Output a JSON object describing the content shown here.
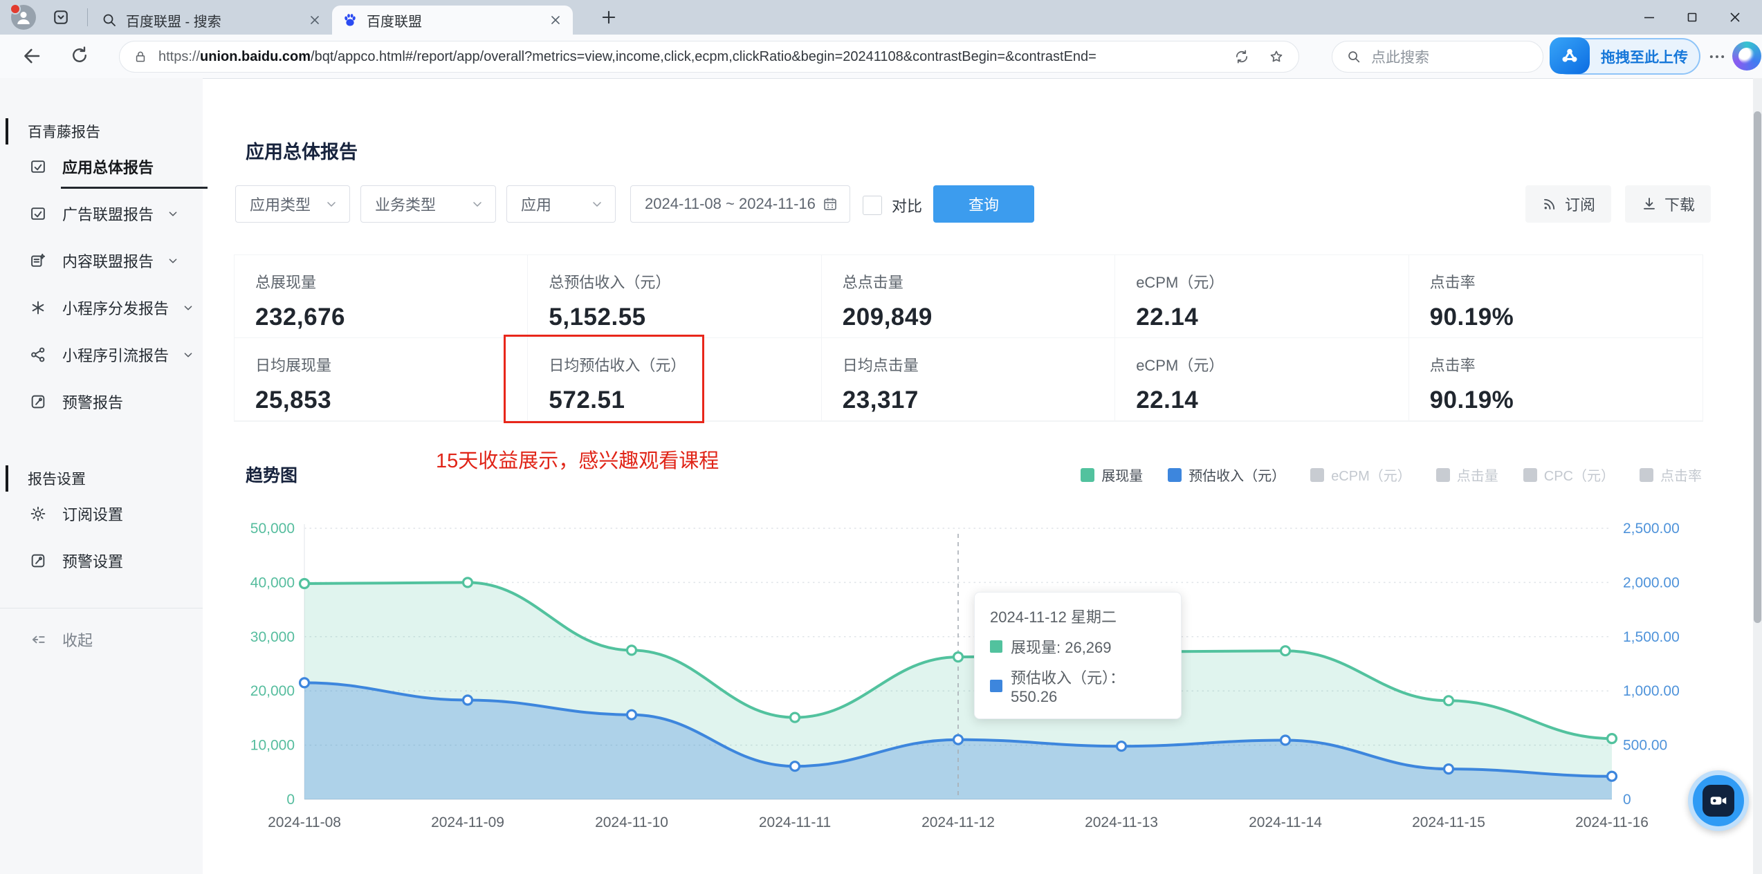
{
  "browser": {
    "tabs": [
      {
        "title": "百度联盟 - 搜索",
        "icon": "search-icon",
        "active": false
      },
      {
        "title": "百度联盟",
        "icon": "baidu-icon",
        "active": true
      }
    ],
    "url": {
      "protocol": "https://",
      "host": "union.baidu.com",
      "path": "/bqt/appco.html#/report/app/overall?metrics=view,income,click,ecpm,clickRatio&begin=20241108&contrastBegin=&contrastEnd="
    },
    "search_placeholder": "点此搜索",
    "netdisk_label": "拖拽至此上传"
  },
  "sidebar": {
    "sections": [
      {
        "header": "百青藤报告",
        "items": [
          {
            "label": "应用总体报告",
            "icon": "overall-report-icon",
            "active": true,
            "chevron": false
          },
          {
            "label": "广告联盟报告",
            "icon": "ad-report-icon",
            "active": false,
            "chevron": true
          },
          {
            "label": "内容联盟报告",
            "icon": "content-report-icon",
            "active": false,
            "chevron": true
          },
          {
            "label": "小程序分发报告",
            "icon": "mini-program-distribute-icon",
            "active": false,
            "chevron": true
          },
          {
            "label": "小程序引流报告",
            "icon": "mini-program-referral-icon",
            "active": false,
            "chevron": true
          },
          {
            "label": "预警报告",
            "icon": "alert-report-icon",
            "active": false,
            "chevron": false
          }
        ]
      },
      {
        "header": "报告设置",
        "items": [
          {
            "label": "订阅设置",
            "icon": "gear-icon",
            "active": false,
            "chevron": false
          },
          {
            "label": "预警设置",
            "icon": "alert-setting-icon",
            "active": false,
            "chevron": false
          }
        ]
      }
    ],
    "collapse_label": "收起"
  },
  "main": {
    "page_title": "应用总体报告",
    "filters": {
      "app_type": "应用类型",
      "biz_type": "业务类型",
      "app": "应用",
      "date_range": "2024-11-08 ~ 2024-11-16",
      "compare_label": "对比",
      "query_label": "查询"
    },
    "actions": {
      "subscribe": "订阅",
      "download": "下载"
    },
    "stats": {
      "rows": [
        [
          {
            "label": "总展现量",
            "value": "232,676"
          },
          {
            "label": "总预估收入（元）",
            "value": "5,152.55"
          },
          {
            "label": "总点击量",
            "value": "209,849"
          },
          {
            "label": "eCPM（元）",
            "value": "22.14"
          },
          {
            "label": "点击率",
            "value": "90.19%"
          }
        ],
        [
          {
            "label": "日均展现量",
            "value": "25,853"
          },
          {
            "label": "日均预估收入（元）",
            "value": "572.51",
            "highlighted": true
          },
          {
            "label": "日均点击量",
            "value": "23,317"
          },
          {
            "label": "eCPM（元）",
            "value": "22.14"
          },
          {
            "label": "点击率",
            "value": "90.19%"
          }
        ]
      ]
    },
    "annotation": "15天收益展示，感兴趣观看课程",
    "trend_title": "趋势图"
  },
  "chart_data": {
    "type": "area",
    "x": [
      "2024-11-08",
      "2024-11-09",
      "2024-11-10",
      "2024-11-11",
      "2024-11-12",
      "2024-11-13",
      "2024-11-14",
      "2024-11-15",
      "2024-11-16"
    ],
    "series": [
      {
        "name": "展现量",
        "axis": "left",
        "color": "#52c29e",
        "fill": "rgba(82,194,158,0.18)",
        "values": [
          39800,
          40000,
          27500,
          15100,
          26269,
          27200,
          27400,
          18200,
          11207
        ],
        "estimated": true
      },
      {
        "name": "预估收入（元）",
        "axis": "right",
        "color": "#3d86dd",
        "fill": "rgba(61,134,221,0.30)",
        "values": [
          1075,
          915,
          780,
          305,
          550.26,
          490,
          545,
          280,
          212.29
        ],
        "estimated": true
      }
    ],
    "disabled_legend": [
      "eCPM（元）",
      "点击量",
      "CPC（元）",
      "点击率"
    ],
    "left_axis": {
      "color": "#56bd9e",
      "min": 0,
      "max": 50000,
      "ticks": [
        "0",
        "10,000",
        "20,000",
        "30,000",
        "40,000",
        "50,000"
      ]
    },
    "right_axis": {
      "color": "#4f93da",
      "min": 0,
      "max": 2500,
      "ticks": [
        "0",
        "500.00",
        "1,000.00",
        "1,500.00",
        "2,000.00",
        "2,500.00"
      ]
    },
    "grid": "dotted",
    "legend_position": "top-right",
    "hover_index": 4,
    "tooltip": {
      "title": "2024-11-12 星期二",
      "rows": [
        {
          "color": "#52c29e",
          "text": "展现量: 26,269"
        },
        {
          "color": "#3d86dd",
          "text": "预估收入（元）：550.26"
        }
      ]
    }
  }
}
